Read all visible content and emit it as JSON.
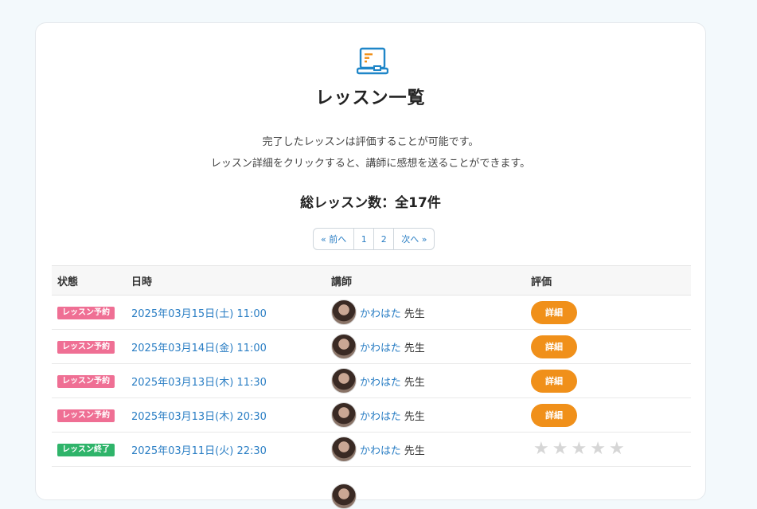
{
  "page": {
    "title": "レッスン一覧",
    "description_line1": "完了したレッスンは評価することが可能です。",
    "description_line2": "レッスン詳細をクリックすると、講師に感想を送ることができます。",
    "total": "総レッスン数：全17件"
  },
  "pagination": {
    "prev": "« 前へ",
    "pages": [
      "1",
      "2"
    ],
    "next": "次へ »"
  },
  "table": {
    "headers": [
      "状態",
      "日時",
      "講師",
      "評価"
    ],
    "rows": [
      {
        "status": "レッスン予約",
        "datetime": "2025年03月15日(土) 11:00",
        "teacher": "かわはた",
        "suffix": "先生",
        "action": "詳細"
      },
      {
        "status": "レッスン予約",
        "datetime": "2025年03月14日(金) 11:00",
        "teacher": "かわはた",
        "suffix": "先生",
        "action": "詳細"
      },
      {
        "status": "レッスン予約",
        "datetime": "2025年03月13日(木) 11:30",
        "teacher": "かわはた",
        "suffix": "先生",
        "action": "詳細"
      },
      {
        "status": "レッスン予約",
        "datetime": "2025年03月13日(木) 20:30",
        "teacher": "かわはた",
        "suffix": "先生",
        "action": "詳細"
      },
      {
        "status": "レッスン終了",
        "datetime": "2025年03月11日(火) 22:30",
        "teacher": "かわはた",
        "suffix": "先生",
        "rating_stars": 0
      }
    ]
  },
  "colors": {
    "accent": "#2a7ec4",
    "reserved_badge": "#ef6f94",
    "done_badge": "#2fb46a",
    "button": "#f0901a"
  },
  "icons": {
    "header": "laptop-icon",
    "rating": "star-icon"
  }
}
